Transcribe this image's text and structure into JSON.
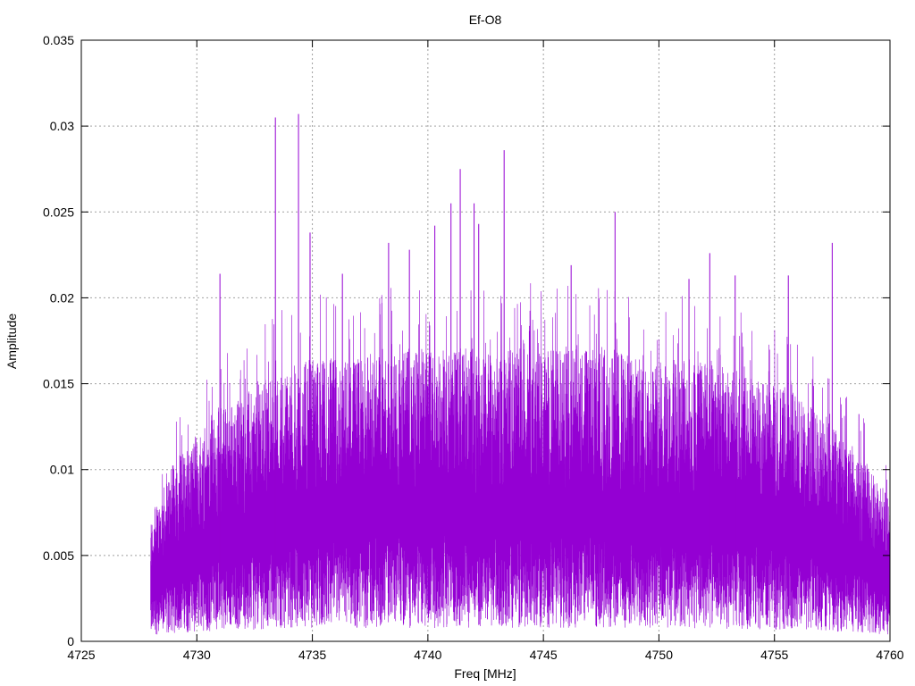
{
  "chart_data": {
    "type": "line",
    "title": "Ef-O8",
    "xlabel": "Freq [MHz]",
    "ylabel": "Amplitude",
    "xlim": [
      4725,
      4760
    ],
    "ylim": [
      0,
      0.035
    ],
    "x_ticks": [
      "4725",
      "4730",
      "4735",
      "4740",
      "4745",
      "4750",
      "4755",
      "4760"
    ],
    "y_ticks": [
      "0",
      "0.005",
      "0.01",
      "0.015",
      "0.02",
      "0.025",
      "0.03",
      "0.035"
    ],
    "grid": true,
    "series_color": "#9400D3",
    "series": [
      {
        "x_start": 4728.0,
        "x_end": 4760.0,
        "envelope_x": [
          4728.0,
          4729.0,
          4730.0,
          4731.0,
          4732.0,
          4733.0,
          4734.0,
          4735.0,
          4736.0,
          4737.0,
          4738.0,
          4739.0,
          4740.0,
          4741.0,
          4742.0,
          4743.0,
          4744.0,
          4745.0,
          4746.0,
          4747.0,
          4748.0,
          4749.0,
          4750.0,
          4751.0,
          4752.0,
          4753.0,
          4754.0,
          4755.0,
          4756.0,
          4757.0,
          4758.0,
          4759.0,
          4760.0
        ],
        "envelope_typical": [
          0.0065,
          0.0095,
          0.011,
          0.0125,
          0.013,
          0.014,
          0.0145,
          0.015,
          0.015,
          0.015,
          0.0155,
          0.0155,
          0.0155,
          0.0155,
          0.0155,
          0.0155,
          0.0155,
          0.0155,
          0.0155,
          0.0155,
          0.0155,
          0.015,
          0.015,
          0.015,
          0.015,
          0.0145,
          0.014,
          0.0135,
          0.013,
          0.012,
          0.011,
          0.0095,
          0.0075
        ],
        "peaks": [
          {
            "x": 4733.4,
            "y": 0.0305
          },
          {
            "x": 4734.4,
            "y": 0.0307
          },
          {
            "x": 4743.3,
            "y": 0.0286
          },
          {
            "x": 4741.4,
            "y": 0.0275
          },
          {
            "x": 4742.0,
            "y": 0.0255
          },
          {
            "x": 4748.1,
            "y": 0.025
          },
          {
            "x": 4740.3,
            "y": 0.0242
          },
          {
            "x": 4757.5,
            "y": 0.0232
          },
          {
            "x": 4738.3,
            "y": 0.0232
          },
          {
            "x": 4739.2,
            "y": 0.0228
          },
          {
            "x": 4731.0,
            "y": 0.0214
          },
          {
            "x": 4755.6,
            "y": 0.0213
          },
          {
            "x": 4736.3,
            "y": 0.0214
          },
          {
            "x": 4751.3,
            "y": 0.0211
          },
          {
            "x": 4746.2,
            "y": 0.0219
          },
          {
            "x": 4734.9,
            "y": 0.0238
          },
          {
            "x": 4741.0,
            "y": 0.0255
          },
          {
            "x": 4742.2,
            "y": 0.0243
          },
          {
            "x": 4752.2,
            "y": 0.0226
          },
          {
            "x": 4753.3,
            "y": 0.0213
          }
        ]
      }
    ]
  }
}
